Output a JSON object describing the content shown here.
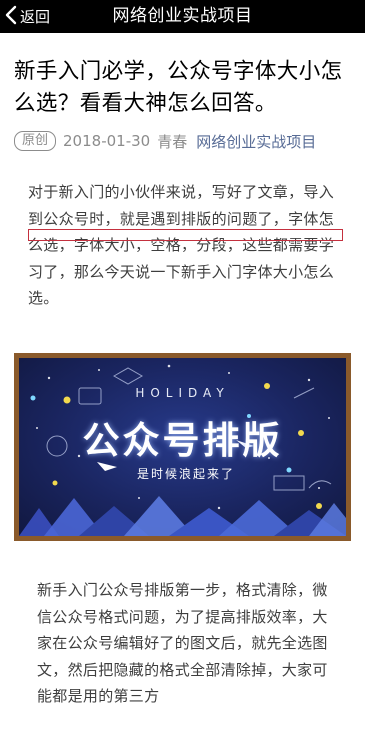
{
  "navbar": {
    "back_label": "返回",
    "title": "网络创业实战项目"
  },
  "article": {
    "title": "新手入门必学，公众号字体大小怎么选？看看大神怎么回答。",
    "badge": "原创",
    "date": "2018-01-30",
    "author": "青春",
    "account": "网络创业实战项目",
    "paragraph1": "对于新入门的小伙伴来说，写好了文章，导入到公众号时，就是遇到排版的问题了，字体怎么选，字体大小，空格，分段，这些都需要学习了，那么今天说一下新手入门字体大小怎么选。",
    "paragraph2": "新手入门公众号排版第一步，格式清除，微信公众号格式问题，为了提高排版效率，大家在公众号编辑好了的图文后，就先全选图文，然后把隐藏的格式全部清除掉，大家可能都是用的第三方"
  },
  "banner": {
    "top_text": "HOLIDAY",
    "headline": "公众号排版",
    "subtext": "是时候浪起来了"
  },
  "colors": {
    "navbar_bg": "#000000",
    "link": "#576b95",
    "meta_gray": "#8c8c8c",
    "highlight_red": "#c4303e",
    "board_blue": "#1a2560",
    "frame_brown": "#8a5a2b"
  },
  "icons": [
    "chevron-left-icon"
  ]
}
